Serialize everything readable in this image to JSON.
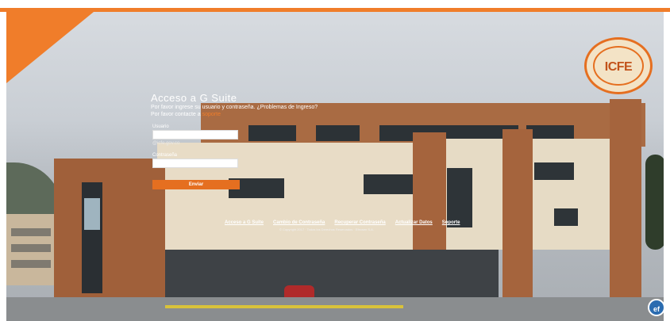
{
  "login": {
    "title": "Acceso a G Suite",
    "description_line1": "Por favor ingrese su usuario y contraseña. ¿Problemas de Ingreso?",
    "description_line2": "Por favor contacte a",
    "support_link": "soporte",
    "username_label": "Usuario",
    "username_value": "",
    "domain_hint": "@icfe.gov.co",
    "password_label": "Contraseña",
    "password_value": "",
    "submit_label": "Enviar"
  },
  "footer": {
    "links": [
      "Acceso a G Suite",
      "Cambio de Contraseña",
      "Recuperar Contraseña",
      "Actualizar Datos",
      "Soporte"
    ],
    "copyright": "© Copyright 2017 · Todos los Derechos Reservados · Efecsen S.A."
  },
  "logo": {
    "text": "ICFE"
  },
  "badge": {
    "text": "ef"
  },
  "colors": {
    "accent": "#f07d2a",
    "white": "#ffffff",
    "badge": "#2b6cb0"
  }
}
